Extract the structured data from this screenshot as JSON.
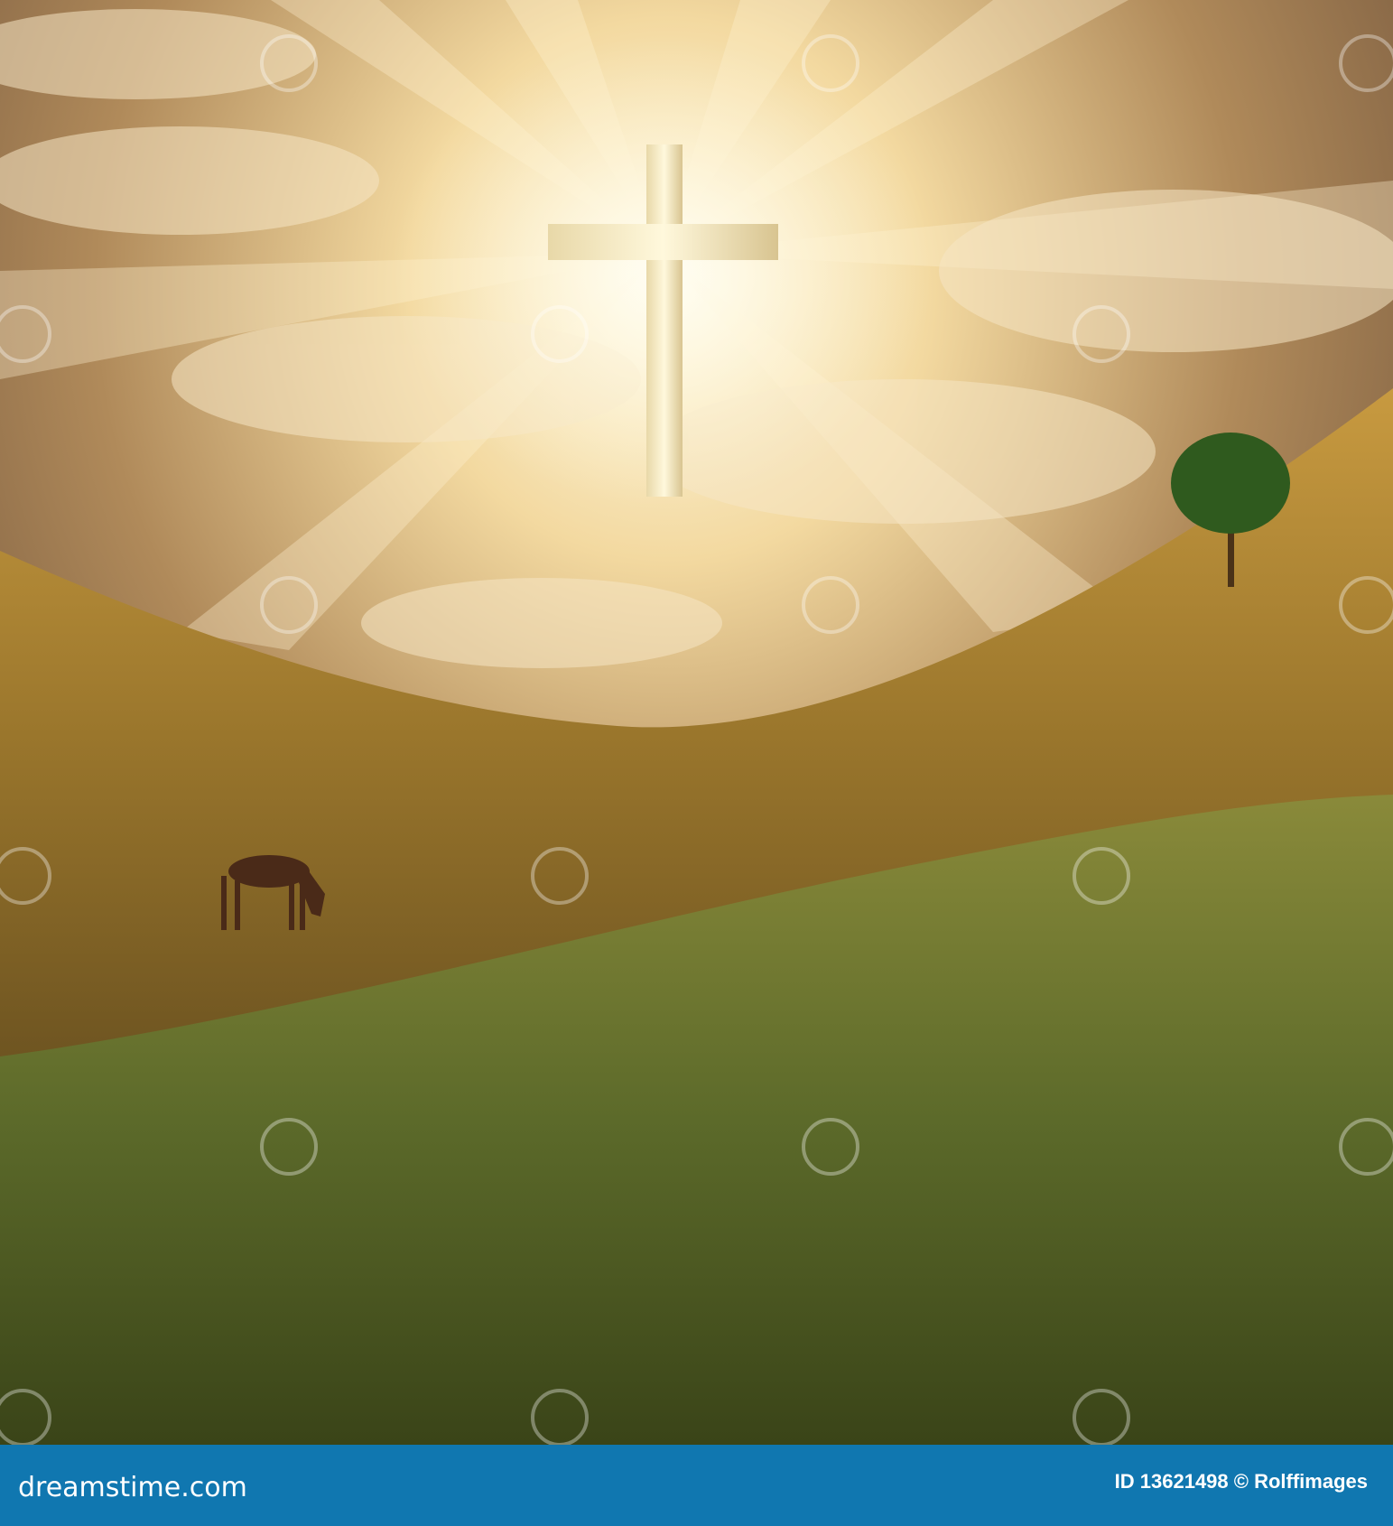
{
  "photo": {
    "subject": "cross-in-sky",
    "watermark_icon": "dreamstime-spiral-icon"
  },
  "footer": {
    "logo_text": "dreamstime.com",
    "credit": "ID 13621498 © Rolffimages"
  },
  "colors": {
    "footer_bg": "#1077b0",
    "sky_glow": "#fff6d8",
    "field_gold": "#9a7a2c",
    "field_green": "#5c6a2a"
  }
}
